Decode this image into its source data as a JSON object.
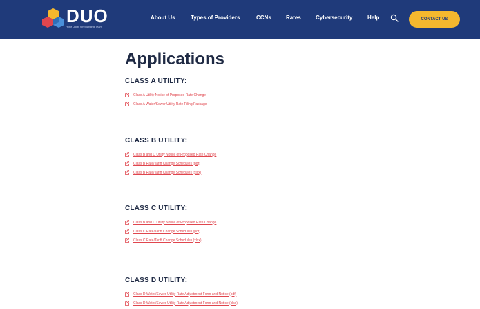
{
  "brand": {
    "name": "DUO",
    "tagline": "Your Utility Onboarding Team"
  },
  "nav": {
    "items": [
      {
        "label": "About Us"
      },
      {
        "label": "Types of Providers"
      },
      {
        "label": "CCNs"
      },
      {
        "label": "Rates"
      },
      {
        "label": "Cybersecurity"
      },
      {
        "label": "Help"
      }
    ],
    "search_icon": "search-icon",
    "contact_label": "CONTACT US"
  },
  "colors": {
    "nav_bg": "#1f3a7a",
    "accent": "#f5b82e",
    "link": "#e0464e",
    "heading": "#1f2a44"
  },
  "page": {
    "title": "Applications",
    "sections": [
      {
        "heading": "CLASS A UTILITY:",
        "links": [
          {
            "text": "Class A Utility Notice of Proposed Rate Change"
          },
          {
            "text": "Class A Water/Sewer Utility Rate Filing Package"
          }
        ]
      },
      {
        "heading": "CLASS B UTILITY:",
        "links": [
          {
            "text": "Class B and C Utility Notice of Proposed Rate Change"
          },
          {
            "text": "Class B Rate/Tariff Change Schedules (pdf)"
          },
          {
            "text": "Class B Rate/Tariff Change Schedules (xlsx)"
          }
        ]
      },
      {
        "heading": "CLASS C UTILITY:",
        "links": [
          {
            "text": "Class B and C Utility Notice of Proposed Rate Change"
          },
          {
            "text": "Class C Rate/Tariff Change Schedules (pdf)"
          },
          {
            "text": "Class C Rate/Tariff Change Schedules (xlsx)"
          }
        ]
      },
      {
        "heading": "CLASS D UTILITY:",
        "links": [
          {
            "text": "Class D Water/Sewer Utility Rate Adjustment Form and Notice (pdf)"
          },
          {
            "text": "Class D Water/Sewer Utility Rate Adjustment Form and Notice (xlsx)"
          }
        ]
      }
    ]
  }
}
